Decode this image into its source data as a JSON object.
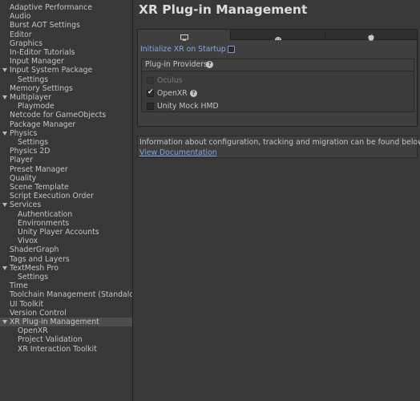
{
  "sidebar": {
    "items": [
      {
        "label": "Adaptive Performance",
        "level": 0,
        "expanded": null,
        "selected": false
      },
      {
        "label": "Audio",
        "level": 0,
        "expanded": null,
        "selected": false
      },
      {
        "label": "Burst AOT Settings",
        "level": 0,
        "expanded": null,
        "selected": false
      },
      {
        "label": "Editor",
        "level": 0,
        "expanded": null,
        "selected": false
      },
      {
        "label": "Graphics",
        "level": 0,
        "expanded": null,
        "selected": false
      },
      {
        "label": "In-Editor Tutorials",
        "level": 0,
        "expanded": null,
        "selected": false
      },
      {
        "label": "Input Manager",
        "level": 0,
        "expanded": null,
        "selected": false
      },
      {
        "label": "Input System Package",
        "level": 0,
        "expanded": true,
        "selected": false
      },
      {
        "label": "Settings",
        "level": 1,
        "expanded": null,
        "selected": false
      },
      {
        "label": "Memory Settings",
        "level": 0,
        "expanded": null,
        "selected": false
      },
      {
        "label": "Multiplayer",
        "level": 0,
        "expanded": true,
        "selected": false
      },
      {
        "label": "Playmode",
        "level": 1,
        "expanded": null,
        "selected": false
      },
      {
        "label": "Netcode for GameObjects",
        "level": 0,
        "expanded": null,
        "selected": false
      },
      {
        "label": "Package Manager",
        "level": 0,
        "expanded": null,
        "selected": false
      },
      {
        "label": "Physics",
        "level": 0,
        "expanded": true,
        "selected": false
      },
      {
        "label": "Settings",
        "level": 1,
        "expanded": null,
        "selected": false
      },
      {
        "label": "Physics 2D",
        "level": 0,
        "expanded": null,
        "selected": false
      },
      {
        "label": "Player",
        "level": 0,
        "expanded": null,
        "selected": false
      },
      {
        "label": "Preset Manager",
        "level": 0,
        "expanded": null,
        "selected": false
      },
      {
        "label": "Quality",
        "level": 0,
        "expanded": null,
        "selected": false
      },
      {
        "label": "Scene Template",
        "level": 0,
        "expanded": null,
        "selected": false
      },
      {
        "label": "Script Execution Order",
        "level": 0,
        "expanded": null,
        "selected": false
      },
      {
        "label": "Services",
        "level": 0,
        "expanded": true,
        "selected": false
      },
      {
        "label": "Authentication",
        "level": 1,
        "expanded": null,
        "selected": false
      },
      {
        "label": "Environments",
        "level": 1,
        "expanded": null,
        "selected": false
      },
      {
        "label": "Unity Player Accounts",
        "level": 1,
        "expanded": null,
        "selected": false
      },
      {
        "label": "Vivox",
        "level": 1,
        "expanded": null,
        "selected": false
      },
      {
        "label": "ShaderGraph",
        "level": 0,
        "expanded": null,
        "selected": false
      },
      {
        "label": "Tags and Layers",
        "level": 0,
        "expanded": null,
        "selected": false
      },
      {
        "label": "TextMesh Pro",
        "level": 0,
        "expanded": true,
        "selected": false
      },
      {
        "label": "Settings",
        "level": 1,
        "expanded": null,
        "selected": false
      },
      {
        "label": "Time",
        "level": 0,
        "expanded": null,
        "selected": false
      },
      {
        "label": "Toolchain Management (Standalone Li",
        "level": 0,
        "expanded": null,
        "selected": false
      },
      {
        "label": "UI Toolkit",
        "level": 0,
        "expanded": null,
        "selected": false
      },
      {
        "label": "Version Control",
        "level": 0,
        "expanded": null,
        "selected": false
      },
      {
        "label": "XR Plug-in Management",
        "level": 0,
        "expanded": true,
        "selected": true
      },
      {
        "label": "OpenXR",
        "level": 1,
        "expanded": null,
        "selected": false
      },
      {
        "label": "Project Validation",
        "level": 1,
        "expanded": null,
        "selected": false
      },
      {
        "label": "XR Interaction Toolkit",
        "level": 1,
        "expanded": null,
        "selected": false
      }
    ]
  },
  "main": {
    "title": "XR Plug-in Management",
    "tabs": [
      {
        "icon": "desktop-icon",
        "active": true
      },
      {
        "icon": "android-icon",
        "active": false
      },
      {
        "icon": "apple-icon",
        "active": false
      }
    ],
    "init_label": "Initialize XR on Startup",
    "init_checked": false,
    "providers_label": "Plug-in Providers",
    "help_glyph": "?",
    "providers": [
      {
        "label": "Oculus",
        "checked": false,
        "disabled": true,
        "help": false
      },
      {
        "label": "OpenXR",
        "checked": true,
        "disabled": false,
        "help": true
      },
      {
        "label": "Unity Mock HMD",
        "checked": false,
        "disabled": false,
        "help": false
      }
    ],
    "info_text": "Information about configuration, tracking and migration can be found below.",
    "doc_link": "View Documentation"
  },
  "colors": {
    "background": "#383838",
    "link": "#7ea6e0",
    "selected_row": "#4d4d4d"
  }
}
